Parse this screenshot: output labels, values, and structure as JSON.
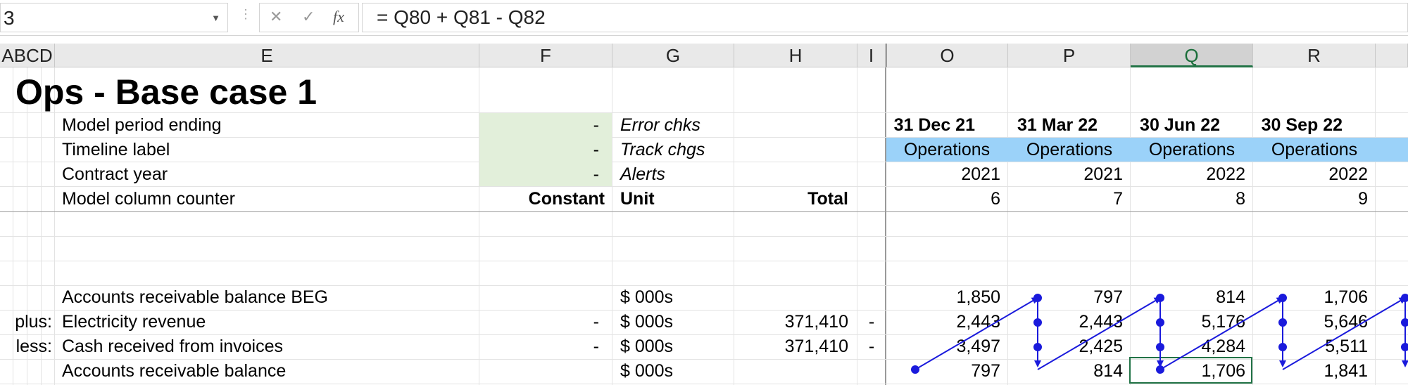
{
  "formula_bar": {
    "name_box": "3",
    "cancel_icon": "✕",
    "enter_icon": "✓",
    "fx_label": "fx",
    "formula": "= Q80 + Q81 - Q82"
  },
  "columns": [
    "ABCD",
    "E",
    "F",
    "G",
    "H",
    "I",
    "O",
    "P",
    "Q",
    "R"
  ],
  "sheet": {
    "title": "Ops - Base case 1",
    "header_rows": [
      {
        "label": "Model period ending",
        "f": "-",
        "g": "Error chks"
      },
      {
        "label": "Timeline label",
        "f": "-",
        "g": "Track chgs"
      },
      {
        "label": "Contract year",
        "f": "-",
        "g": "Alerts"
      },
      {
        "label": "Model column counter",
        "f": "Constant",
        "g": "Unit",
        "h": "Total"
      }
    ],
    "periods": [
      "31 Dec 21",
      "31 Mar 22",
      "30 Jun 22",
      "30 Sep 22"
    ],
    "timeline": [
      "Operations",
      "Operations",
      "Operations",
      "Operations"
    ],
    "years": [
      "2021",
      "2021",
      "2022",
      "2022"
    ],
    "counter": [
      "6",
      "7",
      "8",
      "9"
    ],
    "data_rows": [
      {
        "prefix": "",
        "label": "Accounts receivable balance BEG",
        "f": "",
        "unit": "$ 000s",
        "total": "",
        "i": "",
        "values": [
          "1,850",
          "797",
          "814",
          "1,706"
        ]
      },
      {
        "prefix": "plus:",
        "label": "Electricity revenue",
        "f": "-",
        "unit": "$ 000s",
        "total": "371,410",
        "i": "-",
        "values": [
          "2,443",
          "2,443",
          "5,176",
          "5,646"
        ]
      },
      {
        "prefix": "less:",
        "label": "Cash received from invoices",
        "f": "-",
        "unit": "$ 000s",
        "total": "371,410",
        "i": "-",
        "values": [
          "3,497",
          "2,425",
          "4,284",
          "5,511"
        ]
      },
      {
        "prefix": "",
        "label": "Accounts receivable balance",
        "f": "",
        "unit": "$ 000s",
        "total": "",
        "i": "",
        "values": [
          "797",
          "814",
          "1,706",
          "1,841"
        ]
      }
    ]
  },
  "colors": {
    "accent_green": "#217346",
    "input_fill": "#e2efda",
    "timeline_fill": "#9bd2f9",
    "trace_arrow": "#1a1adc"
  }
}
